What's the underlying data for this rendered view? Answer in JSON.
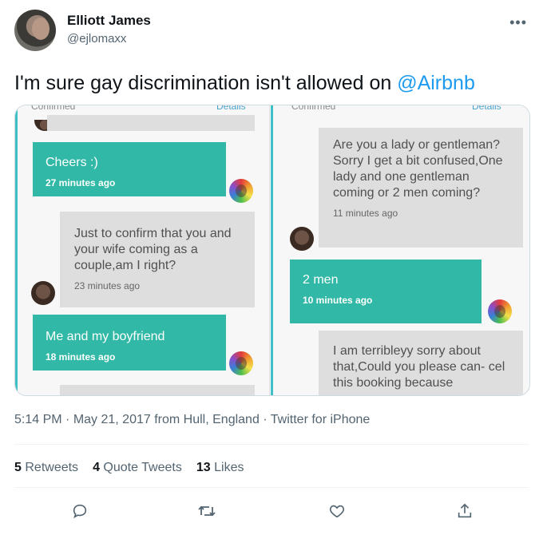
{
  "author": {
    "name": "Elliott James",
    "handle": "@ejlomaxx"
  },
  "tweet": {
    "text_prefix": "I'm sure gay discrimination isn't allowed on ",
    "mention": "@Airbnb"
  },
  "media": {
    "left_panel": {
      "top_left_cut": "Confirmed",
      "top_right_cut": "Details",
      "messages": [
        {
          "side": "host",
          "text": "Cheers :)",
          "time": "27 minutes ago"
        },
        {
          "side": "guest",
          "text": "Just to confirm that you and your wife coming as a couple,am I right?",
          "time": "23 minutes ago"
        },
        {
          "side": "host",
          "text": "Me and my boyfriend",
          "time": "18 minutes ago"
        }
      ]
    },
    "right_panel": {
      "top_left_cut": "Confirmed",
      "top_right_cut": "Details",
      "messages": [
        {
          "side": "guest",
          "text": "Are you a lady or gentleman? Sorry I get a bit confused,One lady and one gentleman coming or 2 men coming?",
          "time": "11 minutes ago"
        },
        {
          "side": "host",
          "text": "2 men",
          "time": "10 minutes ago"
        },
        {
          "side": "guest",
          "text": "I am terribleyy sorry about that,Could you please can- cel this booking because",
          "time": ""
        }
      ]
    }
  },
  "meta": {
    "time": "5:14 PM",
    "date": "May 21, 2017",
    "location": "from Hull, England",
    "client": "Twitter for iPhone"
  },
  "stats": {
    "retweets_count": "5",
    "retweets_label": "Retweets",
    "quotes_count": "4",
    "quotes_label": "Quote Tweets",
    "likes_count": "13",
    "likes_label": "Likes"
  },
  "icons": [
    "more-icon",
    "reply-icon",
    "retweet-icon",
    "like-icon",
    "share-icon"
  ],
  "colors": {
    "accent": "#1d9bf0",
    "bubble_green": "#31b8a6"
  }
}
